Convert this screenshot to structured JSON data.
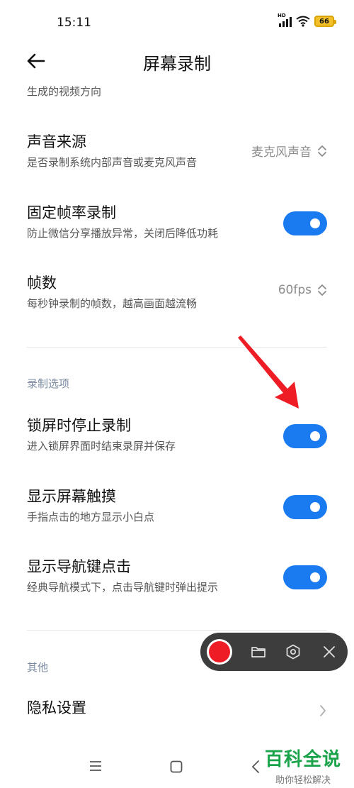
{
  "status": {
    "time": "15:11",
    "signal_badge": "HD",
    "battery": "66"
  },
  "header": {
    "title": "屏幕录制"
  },
  "partial_item": {
    "subtitle": "生成的视频方向"
  },
  "settings": {
    "audio_source": {
      "title": "声音来源",
      "subtitle": "是否录制系统内部声音或麦克风声音",
      "value": "麦克风声音"
    },
    "fixed_fps": {
      "title": "固定帧率录制",
      "subtitle": "防止微信分享播放异常，关闭后降低功耗",
      "enabled": true
    },
    "fps": {
      "title": "帧数",
      "subtitle": "每秒钟录制的帧数，越高画面越流畅",
      "value": "60fps"
    }
  },
  "recording_options": {
    "header": "录制选项",
    "stop_on_lock": {
      "title": "锁屏时停止录制",
      "subtitle": "进入锁屏界面时结束录屏并保存",
      "enabled": true
    },
    "show_touches": {
      "title": "显示屏幕触摸",
      "subtitle": "手指点击的地方显示小白点",
      "enabled": true
    },
    "show_nav_keys": {
      "title": "显示导航键点击",
      "subtitle": "经典导航模式下，点击导航键时弹出提示",
      "enabled": true
    }
  },
  "other": {
    "header": "其他",
    "privacy": {
      "title": "隐私设置"
    }
  },
  "recorder": {
    "icons": [
      "record-icon",
      "folder-icon",
      "settings-hex-icon",
      "close-icon"
    ]
  },
  "watermark": {
    "main": "百科全说",
    "sub": "助你轻松解决"
  },
  "colors": {
    "accent": "#1a7bf0",
    "record": "#ee1c25",
    "annotation": "#ee1c25",
    "watermark": "#1aa34a"
  }
}
